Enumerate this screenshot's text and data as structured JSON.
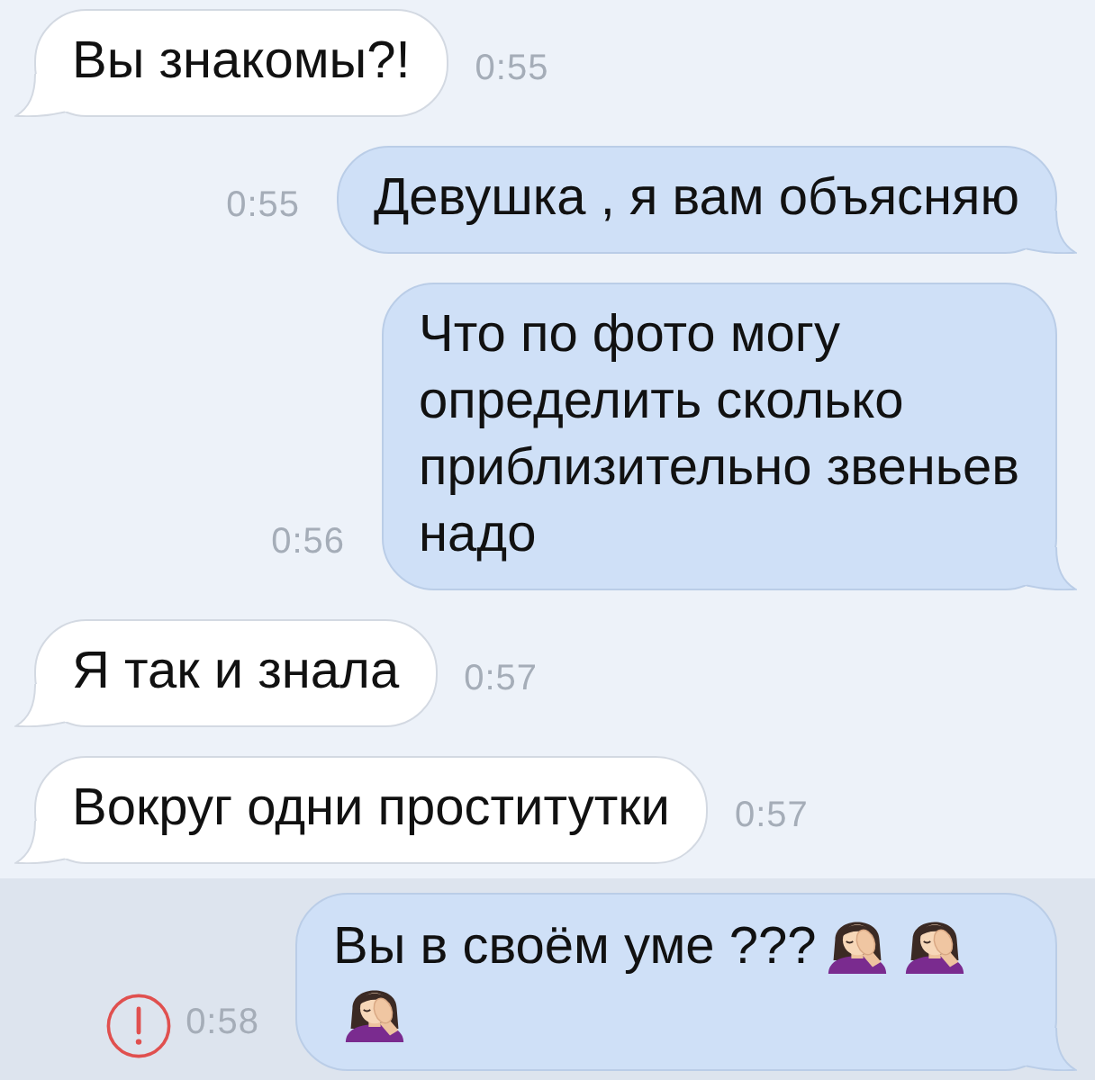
{
  "messages": [
    {
      "kind": "incoming",
      "text": "Вы знакомы?!",
      "time": "0:55",
      "failed": false,
      "highlighted": false
    },
    {
      "kind": "outgoing",
      "text": "Девушка , я вам объясняю",
      "time": "0:55",
      "failed": false,
      "highlighted": false
    },
    {
      "kind": "outgoing",
      "text": "Что по фото могу\nопределить сколько\nприблизительно звеньев\nнадо",
      "time": "0:56",
      "failed": false,
      "highlighted": false
    },
    {
      "kind": "incoming",
      "text": "Я так и знала",
      "time": "0:57",
      "failed": false,
      "highlighted": false
    },
    {
      "kind": "incoming",
      "text": "Вокруг одни проститутки",
      "time": "0:57",
      "failed": false,
      "highlighted": false
    },
    {
      "kind": "outgoing",
      "text": "Вы в своём уме ???",
      "emojis": [
        {
          "kind": "facepalm"
        },
        {
          "kind": "facepalm"
        },
        {
          "kind": "facepalm"
        }
      ],
      "time": "0:58",
      "failed": true,
      "highlighted": true
    }
  ]
}
